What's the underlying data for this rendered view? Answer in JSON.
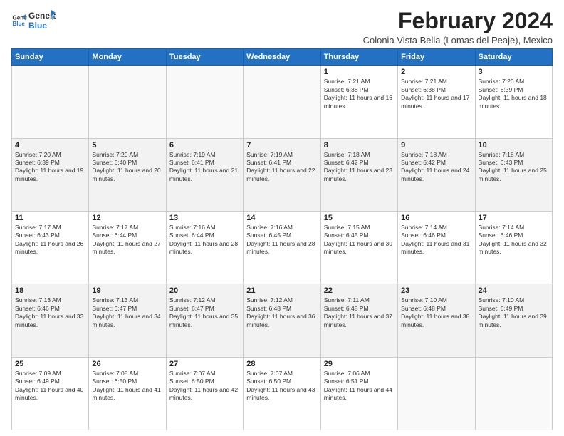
{
  "logo": {
    "line1": "General",
    "line2": "Blue"
  },
  "title": "February 2024",
  "subtitle": "Colonia Vista Bella (Lomas del Peaje), Mexico",
  "days_of_week": [
    "Sunday",
    "Monday",
    "Tuesday",
    "Wednesday",
    "Thursday",
    "Friday",
    "Saturday"
  ],
  "weeks": [
    [
      {
        "day": "",
        "info": ""
      },
      {
        "day": "",
        "info": ""
      },
      {
        "day": "",
        "info": ""
      },
      {
        "day": "",
        "info": ""
      },
      {
        "day": "1",
        "info": "Sunrise: 7:21 AM\nSunset: 6:38 PM\nDaylight: 11 hours and 16 minutes."
      },
      {
        "day": "2",
        "info": "Sunrise: 7:21 AM\nSunset: 6:38 PM\nDaylight: 11 hours and 17 minutes."
      },
      {
        "day": "3",
        "info": "Sunrise: 7:20 AM\nSunset: 6:39 PM\nDaylight: 11 hours and 18 minutes."
      }
    ],
    [
      {
        "day": "4",
        "info": "Sunrise: 7:20 AM\nSunset: 6:39 PM\nDaylight: 11 hours and 19 minutes."
      },
      {
        "day": "5",
        "info": "Sunrise: 7:20 AM\nSunset: 6:40 PM\nDaylight: 11 hours and 20 minutes."
      },
      {
        "day": "6",
        "info": "Sunrise: 7:19 AM\nSunset: 6:41 PM\nDaylight: 11 hours and 21 minutes."
      },
      {
        "day": "7",
        "info": "Sunrise: 7:19 AM\nSunset: 6:41 PM\nDaylight: 11 hours and 22 minutes."
      },
      {
        "day": "8",
        "info": "Sunrise: 7:18 AM\nSunset: 6:42 PM\nDaylight: 11 hours and 23 minutes."
      },
      {
        "day": "9",
        "info": "Sunrise: 7:18 AM\nSunset: 6:42 PM\nDaylight: 11 hours and 24 minutes."
      },
      {
        "day": "10",
        "info": "Sunrise: 7:18 AM\nSunset: 6:43 PM\nDaylight: 11 hours and 25 minutes."
      }
    ],
    [
      {
        "day": "11",
        "info": "Sunrise: 7:17 AM\nSunset: 6:43 PM\nDaylight: 11 hours and 26 minutes."
      },
      {
        "day": "12",
        "info": "Sunrise: 7:17 AM\nSunset: 6:44 PM\nDaylight: 11 hours and 27 minutes."
      },
      {
        "day": "13",
        "info": "Sunrise: 7:16 AM\nSunset: 6:44 PM\nDaylight: 11 hours and 28 minutes."
      },
      {
        "day": "14",
        "info": "Sunrise: 7:16 AM\nSunset: 6:45 PM\nDaylight: 11 hours and 28 minutes."
      },
      {
        "day": "15",
        "info": "Sunrise: 7:15 AM\nSunset: 6:45 PM\nDaylight: 11 hours and 30 minutes."
      },
      {
        "day": "16",
        "info": "Sunrise: 7:14 AM\nSunset: 6:46 PM\nDaylight: 11 hours and 31 minutes."
      },
      {
        "day": "17",
        "info": "Sunrise: 7:14 AM\nSunset: 6:46 PM\nDaylight: 11 hours and 32 minutes."
      }
    ],
    [
      {
        "day": "18",
        "info": "Sunrise: 7:13 AM\nSunset: 6:46 PM\nDaylight: 11 hours and 33 minutes."
      },
      {
        "day": "19",
        "info": "Sunrise: 7:13 AM\nSunset: 6:47 PM\nDaylight: 11 hours and 34 minutes."
      },
      {
        "day": "20",
        "info": "Sunrise: 7:12 AM\nSunset: 6:47 PM\nDaylight: 11 hours and 35 minutes."
      },
      {
        "day": "21",
        "info": "Sunrise: 7:12 AM\nSunset: 6:48 PM\nDaylight: 11 hours and 36 minutes."
      },
      {
        "day": "22",
        "info": "Sunrise: 7:11 AM\nSunset: 6:48 PM\nDaylight: 11 hours and 37 minutes."
      },
      {
        "day": "23",
        "info": "Sunrise: 7:10 AM\nSunset: 6:48 PM\nDaylight: 11 hours and 38 minutes."
      },
      {
        "day": "24",
        "info": "Sunrise: 7:10 AM\nSunset: 6:49 PM\nDaylight: 11 hours and 39 minutes."
      }
    ],
    [
      {
        "day": "25",
        "info": "Sunrise: 7:09 AM\nSunset: 6:49 PM\nDaylight: 11 hours and 40 minutes."
      },
      {
        "day": "26",
        "info": "Sunrise: 7:08 AM\nSunset: 6:50 PM\nDaylight: 11 hours and 41 minutes."
      },
      {
        "day": "27",
        "info": "Sunrise: 7:07 AM\nSunset: 6:50 PM\nDaylight: 11 hours and 42 minutes."
      },
      {
        "day": "28",
        "info": "Sunrise: 7:07 AM\nSunset: 6:50 PM\nDaylight: 11 hours and 43 minutes."
      },
      {
        "day": "29",
        "info": "Sunrise: 7:06 AM\nSunset: 6:51 PM\nDaylight: 11 hours and 44 minutes."
      },
      {
        "day": "",
        "info": ""
      },
      {
        "day": "",
        "info": ""
      }
    ]
  ]
}
